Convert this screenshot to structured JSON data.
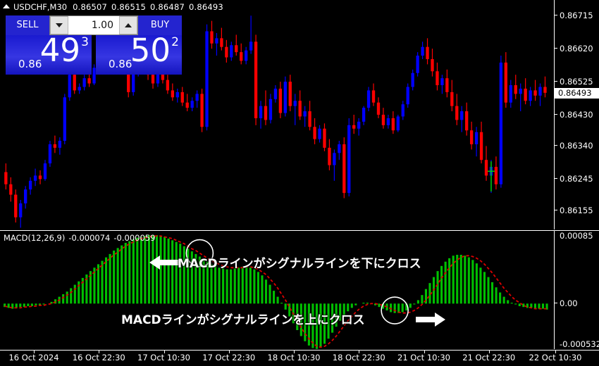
{
  "window": {
    "symbol_header": {
      "collapse_icon": "triangle-up-icon",
      "symbol": "USDCHF,M30",
      "open": "0.86507",
      "high": "0.86515",
      "low": "0.86487",
      "close": "0.86493"
    }
  },
  "trade_widget": {
    "sell_label": "SELL",
    "buy_label": "BUY",
    "volume_value": "1.00",
    "volume_down_icon": "caret-down-icon",
    "volume_up_icon": "caret-up-icon",
    "sell_price": {
      "prefix": "0.86",
      "big": "49",
      "sup": "3"
    },
    "buy_price": {
      "prefix": "0.86",
      "big": "50",
      "sup": "2"
    }
  },
  "price_axis": {
    "labels": [
      "0.86715",
      "0.86620",
      "0.86525",
      "0.86430",
      "0.86340",
      "0.86245",
      "0.86155"
    ],
    "current_price": "0.86493"
  },
  "macd": {
    "label": "MACD(12,26,9)",
    "value_macd": "-0.000074",
    "value_signal": "-0.000059",
    "axis_labels": [
      "0.00085",
      "0.00",
      "-0.000532"
    ],
    "histogram_color": "#00c000",
    "signal_color": "#dd0000"
  },
  "annotations": {
    "cross_down": "MACDラインがシグナルラインを下にクロス",
    "cross_up": "MACDラインがシグナルラインを上にクロス",
    "arrow_left_icon": "arrow-left-icon",
    "arrow_right_icon": "arrow-right-icon",
    "marker_icon": "circle-marker-icon"
  },
  "time_axis": {
    "labels": [
      "16 Oct 2024",
      "16 Oct 22:30",
      "17 Oct 10:30",
      "17 Oct 22:30",
      "18 Oct 10:30",
      "18 Oct 22:30",
      "21 Oct 10:30",
      "21 Oct 22:30",
      "22 Oct 10:30"
    ]
  },
  "colors": {
    "bull_candle": "#0000ff",
    "bear_candle": "#ff0000",
    "background": "#000000",
    "axis_text": "#ffffff",
    "trade_panel": "#2424cf"
  },
  "chart_data": {
    "type": "candlestick",
    "title": "USDCHF,M30",
    "xlabel": "",
    "ylabel": "",
    "ylim": [
      0.861,
      0.8676
    ],
    "grid": false,
    "legend": "none",
    "candles": [
      {
        "o": 0.86265,
        "h": 0.8629,
        "l": 0.86215,
        "c": 0.8623
      },
      {
        "o": 0.8623,
        "h": 0.8625,
        "l": 0.8618,
        "c": 0.862
      },
      {
        "o": 0.862,
        "h": 0.86215,
        "l": 0.8612,
        "c": 0.86135
      },
      {
        "o": 0.86135,
        "h": 0.86185,
        "l": 0.86105,
        "c": 0.86175
      },
      {
        "o": 0.86175,
        "h": 0.86225,
        "l": 0.8616,
        "c": 0.86215
      },
      {
        "o": 0.86215,
        "h": 0.8625,
        "l": 0.862,
        "c": 0.8624
      },
      {
        "o": 0.8624,
        "h": 0.86275,
        "l": 0.86225,
        "c": 0.86255
      },
      {
        "o": 0.86255,
        "h": 0.8627,
        "l": 0.8623,
        "c": 0.86245
      },
      {
        "o": 0.86245,
        "h": 0.863,
        "l": 0.8624,
        "c": 0.8629
      },
      {
        "o": 0.8629,
        "h": 0.86355,
        "l": 0.8628,
        "c": 0.86345
      },
      {
        "o": 0.86345,
        "h": 0.8637,
        "l": 0.8632,
        "c": 0.86335
      },
      {
        "o": 0.86335,
        "h": 0.86365,
        "l": 0.86315,
        "c": 0.86355
      },
      {
        "o": 0.86355,
        "h": 0.8649,
        "l": 0.86345,
        "c": 0.8648
      },
      {
        "o": 0.8648,
        "h": 0.8656,
        "l": 0.8647,
        "c": 0.86545
      },
      {
        "o": 0.86545,
        "h": 0.86555,
        "l": 0.8649,
        "c": 0.865
      },
      {
        "o": 0.865,
        "h": 0.8652,
        "l": 0.8649,
        "c": 0.8651
      },
      {
        "o": 0.8651,
        "h": 0.86545,
        "l": 0.865,
        "c": 0.86535
      },
      {
        "o": 0.86535,
        "h": 0.8656,
        "l": 0.8651,
        "c": 0.8652
      },
      {
        "o": 0.8652,
        "h": 0.86575,
        "l": 0.86515,
        "c": 0.86565
      },
      {
        "o": 0.86565,
        "h": 0.866,
        "l": 0.86555,
        "c": 0.8659
      },
      {
        "o": 0.8659,
        "h": 0.86625,
        "l": 0.8658,
        "c": 0.86615
      },
      {
        "o": 0.86615,
        "h": 0.8666,
        "l": 0.86605,
        "c": 0.8665
      },
      {
        "o": 0.8665,
        "h": 0.8669,
        "l": 0.86635,
        "c": 0.8666
      },
      {
        "o": 0.8666,
        "h": 0.8668,
        "l": 0.86605,
        "c": 0.86615
      },
      {
        "o": 0.86615,
        "h": 0.8664,
        "l": 0.8656,
        "c": 0.86575
      },
      {
        "o": 0.86575,
        "h": 0.866,
        "l": 0.8648,
        "c": 0.86495
      },
      {
        "o": 0.86495,
        "h": 0.8656,
        "l": 0.86485,
        "c": 0.8655
      },
      {
        "o": 0.8655,
        "h": 0.86595,
        "l": 0.8654,
        "c": 0.86585
      },
      {
        "o": 0.86585,
        "h": 0.8662,
        "l": 0.8656,
        "c": 0.86575
      },
      {
        "o": 0.86575,
        "h": 0.86595,
        "l": 0.8653,
        "c": 0.86545
      },
      {
        "o": 0.86545,
        "h": 0.86565,
        "l": 0.86505,
        "c": 0.8652
      },
      {
        "o": 0.8652,
        "h": 0.8657,
        "l": 0.8651,
        "c": 0.8656
      },
      {
        "o": 0.8656,
        "h": 0.8658,
        "l": 0.8652,
        "c": 0.8653
      },
      {
        "o": 0.8653,
        "h": 0.86545,
        "l": 0.8649,
        "c": 0.865
      },
      {
        "o": 0.865,
        "h": 0.8652,
        "l": 0.8647,
        "c": 0.8648
      },
      {
        "o": 0.8648,
        "h": 0.86505,
        "l": 0.86465,
        "c": 0.86495
      },
      {
        "o": 0.86495,
        "h": 0.8651,
        "l": 0.86455,
        "c": 0.86465
      },
      {
        "o": 0.86465,
        "h": 0.8649,
        "l": 0.8644,
        "c": 0.8645
      },
      {
        "o": 0.8645,
        "h": 0.8648,
        "l": 0.8644,
        "c": 0.8647
      },
      {
        "o": 0.8647,
        "h": 0.865,
        "l": 0.8645,
        "c": 0.8649
      },
      {
        "o": 0.8649,
        "h": 0.86505,
        "l": 0.8638,
        "c": 0.86395
      },
      {
        "o": 0.86395,
        "h": 0.8669,
        "l": 0.86385,
        "c": 0.8667
      },
      {
        "o": 0.8667,
        "h": 0.867,
        "l": 0.8662,
        "c": 0.86635
      },
      {
        "o": 0.86635,
        "h": 0.86665,
        "l": 0.866,
        "c": 0.8665
      },
      {
        "o": 0.8665,
        "h": 0.8668,
        "l": 0.86615,
        "c": 0.86625
      },
      {
        "o": 0.86625,
        "h": 0.86645,
        "l": 0.8658,
        "c": 0.86595
      },
      {
        "o": 0.86595,
        "h": 0.8664,
        "l": 0.86585,
        "c": 0.8663
      },
      {
        "o": 0.8663,
        "h": 0.8666,
        "l": 0.866,
        "c": 0.8661
      },
      {
        "o": 0.8661,
        "h": 0.86635,
        "l": 0.86575,
        "c": 0.86585
      },
      {
        "o": 0.86585,
        "h": 0.86625,
        "l": 0.86575,
        "c": 0.86615
      },
      {
        "o": 0.86615,
        "h": 0.86715,
        "l": 0.86605,
        "c": 0.8664
      },
      {
        "o": 0.8664,
        "h": 0.8666,
        "l": 0.864,
        "c": 0.8642
      },
      {
        "o": 0.8642,
        "h": 0.8647,
        "l": 0.8639,
        "c": 0.86455
      },
      {
        "o": 0.86455,
        "h": 0.865,
        "l": 0.864,
        "c": 0.86415
      },
      {
        "o": 0.86415,
        "h": 0.8649,
        "l": 0.86405,
        "c": 0.86475
      },
      {
        "o": 0.86475,
        "h": 0.86515,
        "l": 0.86465,
        "c": 0.86505
      },
      {
        "o": 0.86505,
        "h": 0.86525,
        "l": 0.8642,
        "c": 0.86435
      },
      {
        "o": 0.86435,
        "h": 0.8654,
        "l": 0.86425,
        "c": 0.86525
      },
      {
        "o": 0.86525,
        "h": 0.86545,
        "l": 0.8644,
        "c": 0.86455
      },
      {
        "o": 0.86455,
        "h": 0.8649,
        "l": 0.864,
        "c": 0.8647
      },
      {
        "o": 0.8647,
        "h": 0.865,
        "l": 0.86415,
        "c": 0.86425
      },
      {
        "o": 0.86425,
        "h": 0.86455,
        "l": 0.86395,
        "c": 0.8644
      },
      {
        "o": 0.8644,
        "h": 0.8647,
        "l": 0.86385,
        "c": 0.86395
      },
      {
        "o": 0.86395,
        "h": 0.8642,
        "l": 0.86345,
        "c": 0.8636
      },
      {
        "o": 0.8636,
        "h": 0.864,
        "l": 0.8635,
        "c": 0.8639
      },
      {
        "o": 0.8639,
        "h": 0.86405,
        "l": 0.86325,
        "c": 0.86335
      },
      {
        "o": 0.86335,
        "h": 0.8636,
        "l": 0.8627,
        "c": 0.86285
      },
      {
        "o": 0.86285,
        "h": 0.8633,
        "l": 0.8624,
        "c": 0.8632
      },
      {
        "o": 0.8632,
        "h": 0.86355,
        "l": 0.863,
        "c": 0.86345
      },
      {
        "o": 0.86345,
        "h": 0.86365,
        "l": 0.8619,
        "c": 0.86205
      },
      {
        "o": 0.86205,
        "h": 0.8642,
        "l": 0.86195,
        "c": 0.864
      },
      {
        "o": 0.864,
        "h": 0.8643,
        "l": 0.86375,
        "c": 0.8639
      },
      {
        "o": 0.8639,
        "h": 0.8642,
        "l": 0.8637,
        "c": 0.8641
      },
      {
        "o": 0.8641,
        "h": 0.86455,
        "l": 0.864,
        "c": 0.8645
      },
      {
        "o": 0.8645,
        "h": 0.8651,
        "l": 0.8644,
        "c": 0.865
      },
      {
        "o": 0.865,
        "h": 0.8652,
        "l": 0.86455,
        "c": 0.86465
      },
      {
        "o": 0.86465,
        "h": 0.8648,
        "l": 0.8642,
        "c": 0.8643
      },
      {
        "o": 0.8643,
        "h": 0.8645,
        "l": 0.8639,
        "c": 0.864
      },
      {
        "o": 0.864,
        "h": 0.8643,
        "l": 0.8639,
        "c": 0.8642
      },
      {
        "o": 0.8642,
        "h": 0.8644,
        "l": 0.86375,
        "c": 0.86385
      },
      {
        "o": 0.86385,
        "h": 0.8643,
        "l": 0.8638,
        "c": 0.86425
      },
      {
        "o": 0.86425,
        "h": 0.8647,
        "l": 0.86415,
        "c": 0.8646
      },
      {
        "o": 0.8646,
        "h": 0.8652,
        "l": 0.8645,
        "c": 0.8651
      },
      {
        "o": 0.8651,
        "h": 0.8656,
        "l": 0.865,
        "c": 0.8655
      },
      {
        "o": 0.8655,
        "h": 0.8661,
        "l": 0.8654,
        "c": 0.866
      },
      {
        "o": 0.866,
        "h": 0.8664,
        "l": 0.8659,
        "c": 0.86625
      },
      {
        "o": 0.86625,
        "h": 0.8665,
        "l": 0.86575,
        "c": 0.8659
      },
      {
        "o": 0.8659,
        "h": 0.8662,
        "l": 0.8654,
        "c": 0.86555
      },
      {
        "o": 0.86555,
        "h": 0.8658,
        "l": 0.865,
        "c": 0.86515
      },
      {
        "o": 0.86515,
        "h": 0.86545,
        "l": 0.8649,
        "c": 0.86535
      },
      {
        "o": 0.86535,
        "h": 0.8656,
        "l": 0.8648,
        "c": 0.86495
      },
      {
        "o": 0.86495,
        "h": 0.8653,
        "l": 0.8644,
        "c": 0.86455
      },
      {
        "o": 0.86455,
        "h": 0.8649,
        "l": 0.864,
        "c": 0.86415
      },
      {
        "o": 0.86415,
        "h": 0.86455,
        "l": 0.8638,
        "c": 0.8644
      },
      {
        "o": 0.8644,
        "h": 0.86465,
        "l": 0.8637,
        "c": 0.86385
      },
      {
        "o": 0.86385,
        "h": 0.8641,
        "l": 0.8633,
        "c": 0.86345
      },
      {
        "o": 0.86345,
        "h": 0.86395,
        "l": 0.8631,
        "c": 0.8638
      },
      {
        "o": 0.8638,
        "h": 0.8641,
        "l": 0.8629,
        "c": 0.863
      },
      {
        "o": 0.863,
        "h": 0.8634,
        "l": 0.8624,
        "c": 0.86255
      },
      {
        "o": 0.86255,
        "h": 0.863,
        "l": 0.86205,
        "c": 0.8628
      },
      {
        "o": 0.8628,
        "h": 0.8631,
        "l": 0.86215,
        "c": 0.8623
      },
      {
        "o": 0.8623,
        "h": 0.866,
        "l": 0.8622,
        "c": 0.8658
      },
      {
        "o": 0.8658,
        "h": 0.8661,
        "l": 0.8645,
        "c": 0.86465
      },
      {
        "o": 0.86465,
        "h": 0.8653,
        "l": 0.8645,
        "c": 0.86515
      },
      {
        "o": 0.86515,
        "h": 0.86545,
        "l": 0.86475,
        "c": 0.8649
      },
      {
        "o": 0.8649,
        "h": 0.8652,
        "l": 0.8644,
        "c": 0.86505
      },
      {
        "o": 0.86505,
        "h": 0.86535,
        "l": 0.8646,
        "c": 0.8647
      },
      {
        "o": 0.8647,
        "h": 0.8651,
        "l": 0.86455,
        "c": 0.865
      },
      {
        "o": 0.865,
        "h": 0.8653,
        "l": 0.8647,
        "c": 0.86485
      },
      {
        "o": 0.86485,
        "h": 0.8652,
        "l": 0.86455,
        "c": 0.8651
      },
      {
        "o": 0.8651,
        "h": 0.8654,
        "l": 0.8648,
        "c": 0.86493
      }
    ],
    "macd_histogram": [
      -4e-05,
      -5e-05,
      -6e-05,
      -5e-05,
      -4e-05,
      -4e-05,
      -3e-05,
      -3e-05,
      -2e-05,
      -2e-05,
      -1e-05,
      0.0,
      2e-05,
      5e-05,
      8e-05,
      0.00011,
      0.00014,
      0.00018,
      0.00022,
      0.00026,
      0.0003,
      0.00034,
      0.00038,
      0.00042,
      0.00046,
      0.0005,
      0.00054,
      0.00058,
      0.00062,
      0.00065,
      0.00068,
      0.00071,
      0.00073,
      0.00075,
      0.00077,
      0.00078,
      0.00079,
      0.0008,
      0.0008,
      0.0008,
      0.00079,
      0.00078,
      0.00076,
      0.00074,
      0.00072,
      0.0007,
      0.00067,
      0.00064,
      0.00061,
      0.00058,
      0.00055,
      0.00052,
      0.00049,
      0.00046,
      0.00044,
      0.00042,
      0.00041,
      0.0004,
      0.0004,
      0.00041,
      0.00042,
      0.00043,
      0.00043,
      0.00042,
      0.0004,
      0.00037,
      0.00033,
      0.00028,
      0.00022,
      0.00015,
      8e-05,
      1e-05,
      -7e-05,
      -0.00015,
      -0.00023,
      -0.00031,
      -0.00038,
      -0.00044,
      -0.00049,
      -0.00052,
      -0.00053,
      -0.00051,
      -0.00047,
      -0.00041,
      -0.00034,
      -0.00027,
      -0.0002,
      -0.00014,
      -9e-05,
      -5e-05,
      -2e-05,
      0.0,
      1e-05,
      1e-05,
      0.0,
      -2e-05,
      -4e-05,
      -6e-05,
      -8e-05,
      -0.0001,
      -0.00011,
      -0.00011,
      -0.0001,
      -8e-05,
      -5e-05,
      -1e-05,
      4e-05,
      0.0001,
      0.00017,
      0.00024,
      0.00031,
      0.00038,
      0.00044,
      0.00049,
      0.00053,
      0.00056,
      0.00057,
      0.00057,
      0.00056,
      0.00054,
      0.00051,
      0.00047,
      0.00042,
      0.00037,
      0.00031,
      0.00025,
      0.00019,
      0.00013,
      8e-05,
      4e-05,
      1e-05,
      -1e-05,
      -3e-05,
      -4e-05,
      -5e-05,
      -5e-05,
      -6e-05,
      -6e-05,
      -6e-05,
      -7e-05
    ],
    "macd_signal_line": [
      -3e-05,
      -4e-05,
      -5e-05,
      -5e-05,
      -5e-05,
      -4e-05,
      -4e-05,
      -3e-05,
      -3e-05,
      -2e-05,
      -2e-05,
      -1e-05,
      0.0,
      2e-05,
      4e-05,
      7e-05,
      0.0001,
      0.00013,
      0.00017,
      0.00021,
      0.00025,
      0.00029,
      0.00033,
      0.00037,
      0.00041,
      0.00045,
      0.00049,
      0.00053,
      0.00057,
      0.0006,
      0.00064,
      0.00067,
      0.0007,
      0.00072,
      0.00074,
      0.00076,
      0.00077,
      0.00078,
      0.00079,
      0.00079,
      0.00079,
      0.00078,
      0.00077,
      0.00076,
      0.00074,
      0.00072,
      0.0007,
      0.00067,
      0.00064,
      0.00062,
      0.00059,
      0.00056,
      0.00053,
      0.0005,
      0.00048,
      0.00046,
      0.00044,
      0.00043,
      0.00042,
      0.00042,
      0.00042,
      0.00042,
      0.00043,
      0.00043,
      0.00042,
      0.0004,
      0.00037,
      0.00034,
      0.00029,
      0.00024,
      0.00018,
      0.00011,
      4e-05,
      -4e-05,
      -0.00012,
      -0.0002,
      -0.00028,
      -0.00035,
      -0.00041,
      -0.00046,
      -0.0005,
      -0.00051,
      -0.0005,
      -0.00047,
      -0.00043,
      -0.00038,
      -0.00032,
      -0.00026,
      -0.0002,
      -0.00015,
      -0.0001,
      -6e-05,
      -3e-05,
      -1e-05,
      0.0,
      0.0,
      -1e-05,
      -2e-05,
      -4e-05,
      -6e-05,
      -8e-05,
      -0.0001,
      -0.00011,
      -0.00011,
      -0.0001,
      -8e-05,
      -5e-05,
      -1e-05,
      4e-05,
      0.0001,
      0.00016,
      0.00023,
      0.0003,
      0.00036,
      0.00042,
      0.00047,
      0.00051,
      0.00054,
      0.00056,
      0.00056,
      0.00055,
      0.00053,
      0.0005,
      0.00046,
      0.00041,
      0.00036,
      0.0003,
      0.00024,
      0.00018,
      0.00013,
      8e-05,
      4e-05,
      1e-05,
      -2e-05,
      -4e-05,
      -5e-05,
      -6e-05,
      -6e-05,
      -6e-05,
      -6e-05
    ],
    "macd_ylim": [
      -0.000532,
      0.00085
    ],
    "crossover_markers": [
      {
        "type": "bearish",
        "label": "cross_down",
        "x_index": 50
      },
      {
        "type": "bullish",
        "label": "cross_up",
        "x_index": 100
      }
    ]
  }
}
